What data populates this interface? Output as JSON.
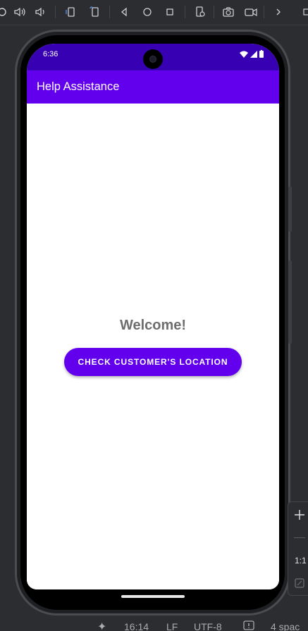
{
  "device": {
    "status_time": "6:36"
  },
  "app": {
    "title": "Help Assistance",
    "welcome_text": "Welcome!",
    "button_label": "CHECK CUSTOMER'S LOCATION"
  },
  "colors": {
    "status_bar": "#3700b3",
    "app_bar": "#6200ee",
    "button": "#6200ee",
    "welcome_text": "#6e6e6e"
  },
  "emulator_toolbar": {
    "icons": [
      "power-icon",
      "volume-up-icon",
      "volume-down-icon",
      "rotate-left-icon",
      "rotate-right-icon",
      "back-icon",
      "home-icon",
      "overview-icon",
      "settings-device-icon",
      "screenshot-icon",
      "screen-record-icon",
      "more-icon"
    ]
  },
  "side_panel": {
    "zoom_label": "1:1"
  },
  "ide_status": {
    "cursor_position": "16:14",
    "line_separator": "LF",
    "encoding": "UTF-8",
    "indent": "4 spac"
  }
}
